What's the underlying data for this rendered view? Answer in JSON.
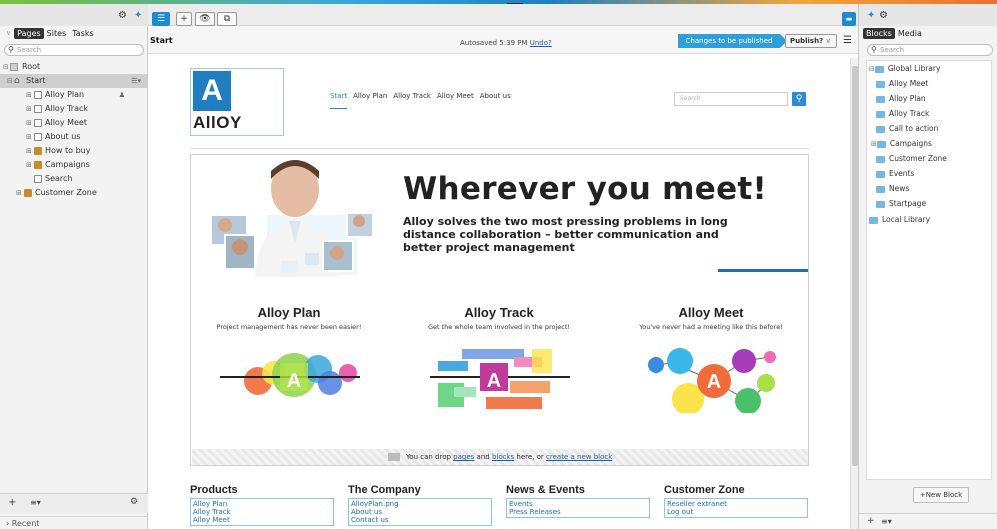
{
  "left_panel": {
    "tabs": [
      "Pages",
      "Sites",
      "Tasks"
    ],
    "search_placeholder": "Search",
    "tree": [
      {
        "label": "Root"
      },
      {
        "label": "Start"
      },
      {
        "label": "Alloy Plan"
      },
      {
        "label": "Alloy Track"
      },
      {
        "label": "Alloy Meet"
      },
      {
        "label": "About us"
      },
      {
        "label": "How to buy"
      },
      {
        "label": "Campaigns"
      },
      {
        "label": "Search"
      },
      {
        "label": "Customer Zone"
      }
    ],
    "recent_label": "Recent"
  },
  "toolbar": {
    "add": "+",
    "view": "👁",
    "preview": "⧉"
  },
  "header": {
    "breadcrumb": "Start",
    "autosave_text": "Autosaved 5:39 PM",
    "undo_label": "Undo?",
    "changes_label": "Changes to be published",
    "publish_label": "Publish?"
  },
  "site": {
    "logo_letter": "A",
    "logo_word": "AllOY",
    "nav": [
      "Start",
      "Alloy Plan",
      "Alloy Track",
      "Alloy Meet",
      "About us"
    ],
    "search_placeholder": "Search",
    "hero_title": "Wherever you meet!",
    "hero_subtitle": "Alloy solves the two most pressing problems in long distance collaboration – better communication and better project management",
    "products": [
      {
        "title": "Alloy Plan",
        "desc": "Project management has never been easier!"
      },
      {
        "title": "Alloy Track",
        "desc": "Get the whole team involved in the project!"
      },
      {
        "title": "Alloy Meet",
        "desc": "You've never had a meeting like this before!"
      }
    ],
    "drop_text_1": "You can drop",
    "drop_link_pages": "pages",
    "drop_text_2": "and",
    "drop_link_blocks": "blocks",
    "drop_text_3": "here, or",
    "drop_link_create": "create a new block",
    "footer": [
      {
        "title": "Products",
        "links": [
          "Alloy Plan",
          "Alloy Track",
          "Alloy Meet"
        ]
      },
      {
        "title": "The Company",
        "links": [
          "AlloyPlan.png",
          "About us",
          "Contact us"
        ]
      },
      {
        "title": "News & Events",
        "links": [
          "Events",
          "Press Releases"
        ]
      },
      {
        "title": "Customer Zone",
        "links": [
          "Reseller extranet",
          "Log out"
        ]
      }
    ]
  },
  "right_panel": {
    "tabs": [
      "Blocks",
      "Media"
    ],
    "search_placeholder": "Search",
    "items": [
      "Global Library",
      "Alloy Meet",
      "Alloy Plan",
      "Alloy Track",
      "Call to action",
      "Campaigns",
      "Customer Zone",
      "Events",
      "News",
      "Startpage",
      "Local Library"
    ],
    "new_block_label": "+New Block"
  },
  "colors": {
    "accent": "#1e8bd0",
    "publish_flag": "#2f9fd9",
    "logo": "#1f7ec1"
  }
}
